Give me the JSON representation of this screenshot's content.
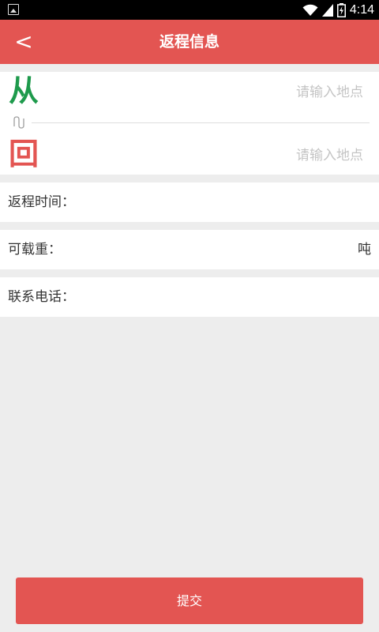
{
  "status_bar": {
    "time": "4:14",
    "icons": [
      "image-notification-icon",
      "wifi-icon",
      "signal-icon",
      "battery-icon"
    ]
  },
  "header": {
    "back_label": "<",
    "title": "返程信息",
    "background_color": "#e35552"
  },
  "route": {
    "from_glyph": "从",
    "from_color": "#1e9a4c",
    "from_placeholder": "请输入地点",
    "back_glyph": "回",
    "back_color": "#e35552",
    "back_placeholder": "请输入地点",
    "swap_icon": "swap-icon"
  },
  "fields": {
    "return_time_label": "返程时间：",
    "capacity_label": "可载重：",
    "capacity_unit": "吨",
    "phone_label": "联系电话："
  },
  "submit": {
    "label": "提交"
  }
}
